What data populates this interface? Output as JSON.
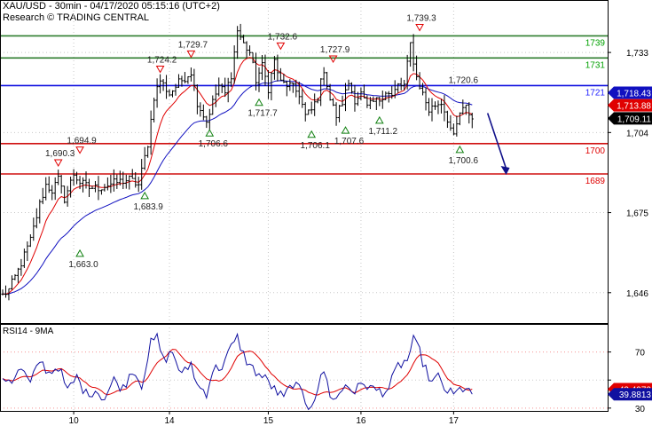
{
  "header": {
    "title": "XAU/USD - 30min - 04/17/2020 05:15:16 (UTC+2)",
    "credit": "Research © TRADING CENTRAL"
  },
  "chart_data": [
    {
      "type": "candlestick",
      "title": "XAU/USD - 30min - 04/17/2020 05:15:16 (UTC+2)",
      "ylim": [
        1635,
        1752
      ],
      "y_ticks": [
        1646,
        1675,
        1704,
        1733
      ],
      "y_tick_labels": [
        "1,646",
        "1,675",
        "1,704",
        "1,733"
      ],
      "x_ticks": [
        {
          "label": "10",
          "index": 23
        },
        {
          "label": "14",
          "index": 54
        },
        {
          "label": "15",
          "index": 86
        },
        {
          "label": "16",
          "index": 116
        },
        {
          "label": "17",
          "index": 146
        }
      ],
      "n_bars": 196,
      "last_bar_index": 152,
      "closes_waypoints": [
        [
          0,
          1645
        ],
        [
          2,
          1647
        ],
        [
          5,
          1654
        ],
        [
          9,
          1665
        ],
        [
          12,
          1678
        ],
        [
          14,
          1685
        ],
        [
          16,
          1683
        ],
        [
          18,
          1687
        ],
        [
          20,
          1680
        ],
        [
          23,
          1689
        ],
        [
          25,
          1686
        ],
        [
          28,
          1684
        ],
        [
          31,
          1684
        ],
        [
          34,
          1685
        ],
        [
          37,
          1686
        ],
        [
          41,
          1687
        ],
        [
          44,
          1685
        ],
        [
          47,
          1700
        ],
        [
          49,
          1717
        ],
        [
          51,
          1723
        ],
        [
          54,
          1718
        ],
        [
          57,
          1722
        ],
        [
          61,
          1726
        ],
        [
          63,
          1715
        ],
        [
          66,
          1708
        ],
        [
          68,
          1715
        ],
        [
          70,
          1721
        ],
        [
          72,
          1718
        ],
        [
          74,
          1725
        ],
        [
          76,
          1741
        ],
        [
          78,
          1736
        ],
        [
          80,
          1733
        ],
        [
          82,
          1723
        ],
        [
          84,
          1728
        ],
        [
          86,
          1720
        ],
        [
          88,
          1730
        ],
        [
          90,
          1722
        ],
        [
          93,
          1721
        ],
        [
          96,
          1718
        ],
        [
          98,
          1710
        ],
        [
          100,
          1712
        ],
        [
          102,
          1717
        ],
        [
          104,
          1727
        ],
        [
          106,
          1716
        ],
        [
          108,
          1710
        ],
        [
          110,
          1715
        ],
        [
          112,
          1722
        ],
        [
          114,
          1716
        ],
        [
          116,
          1718
        ],
        [
          118,
          1713
        ],
        [
          120,
          1715
        ],
        [
          122,
          1716
        ],
        [
          124,
          1719
        ],
        [
          126,
          1717
        ],
        [
          128,
          1721
        ],
        [
          130,
          1721
        ],
        [
          132,
          1736
        ],
        [
          134,
          1724
        ],
        [
          136,
          1718
        ],
        [
          138,
          1712
        ],
        [
          140,
          1714
        ],
        [
          142,
          1715
        ],
        [
          144,
          1709
        ],
        [
          146,
          1702
        ],
        [
          148,
          1711
        ],
        [
          150,
          1713
        ],
        [
          152,
          1709
        ]
      ],
      "series": [
        {
          "name": "price",
          "color": "#000000"
        },
        {
          "name": "ma_fast",
          "color": "#e00000"
        },
        {
          "name": "ma_slow",
          "color": "#1010c0"
        }
      ],
      "horizontal_levels": [
        {
          "value": 1739,
          "label": "1739",
          "color": "#00a000",
          "line_color": "#2e7d2e"
        },
        {
          "value": 1731,
          "label": "1731",
          "color": "#00a000",
          "line_color": "#2e7d2e"
        },
        {
          "value": 1721,
          "label": "1721",
          "color": "#1d1dff",
          "line_color": "#1010e0"
        },
        {
          "value": 1700,
          "label": "1700",
          "color": "#e00000",
          "line_color": "#d01010"
        },
        {
          "value": 1689,
          "label": "1689",
          "color": "#e00000",
          "line_color": "#d01010"
        }
      ],
      "price_tags": [
        {
          "value": 1718.43,
          "label": "1,718.43",
          "bg": "#1010c0",
          "fg": "#ffffff"
        },
        {
          "value": 1713.88,
          "label": "1,713.88",
          "bg": "#e00000",
          "fg": "#ffffff"
        },
        {
          "value": 1709.11,
          "label": "1,709.11",
          "bg": "#000000",
          "fg": "#ffffff"
        }
      ],
      "annotations": [
        {
          "text": "1,690.3",
          "index": 18,
          "value": 1690.3,
          "type": "high"
        },
        {
          "text": "1,694.9",
          "index": 25,
          "value": 1694.9,
          "type": "high"
        },
        {
          "text": "1,663.0",
          "index": 25,
          "value": 1663.0,
          "type": "low"
        },
        {
          "text": "1,683.9",
          "index": 46,
          "value": 1683.9,
          "type": "low"
        },
        {
          "text": "1,724.2",
          "index": 51,
          "value": 1724.2,
          "type": "high"
        },
        {
          "text": "1,729.7",
          "index": 61,
          "value": 1729.7,
          "type": "high"
        },
        {
          "text": "1,706.6",
          "index": 67,
          "value": 1706.6,
          "type": "low"
        },
        {
          "text": "1,717.7",
          "index": 83,
          "value": 1717.7,
          "type": "low"
        },
        {
          "text": "1,732.6",
          "index": 90,
          "value": 1732.6,
          "type": "high"
        },
        {
          "text": "1,706.1",
          "index": 100,
          "value": 1706.1,
          "type": "low"
        },
        {
          "text": "1,727.9",
          "index": 107,
          "value": 1727.9,
          "type": "high"
        },
        {
          "text": "1,707.6",
          "index": 111,
          "value": 1707.6,
          "type": "low"
        },
        {
          "text": "1,711.2",
          "index": 122,
          "value": 1711.2,
          "type": "low"
        },
        {
          "text": "1,739.3",
          "index": 135,
          "value": 1739.3,
          "type": "high"
        },
        {
          "text": "1,720.6",
          "index": 148,
          "value": 1720.6,
          "type": "none"
        },
        {
          "text": "1,700.6",
          "index": 148,
          "value": 1700.6,
          "type": "low"
        }
      ],
      "projection_arrow": {
        "from_index": 157,
        "from_value": 1711,
        "to_index": 163,
        "to_value": 1689,
        "color": "#10108a"
      },
      "grid": true
    },
    {
      "type": "line",
      "title": "RSI14 - 9MA",
      "ylim": [
        28,
        90
      ],
      "y_ticks": [
        30,
        50,
        70
      ],
      "y_tick_labels": [
        "30",
        "50",
        "70"
      ],
      "rsi_waypoints": [
        [
          0,
          52
        ],
        [
          3,
          50
        ],
        [
          6,
          58
        ],
        [
          9,
          47
        ],
        [
          12,
          64
        ],
        [
          15,
          55
        ],
        [
          18,
          60
        ],
        [
          21,
          42
        ],
        [
          24,
          52
        ],
        [
          27,
          40
        ],
        [
          30,
          43
        ],
        [
          33,
          37
        ],
        [
          36,
          50
        ],
        [
          39,
          44
        ],
        [
          42,
          58
        ],
        [
          45,
          47
        ],
        [
          48,
          76
        ],
        [
          50,
          80
        ],
        [
          52,
          64
        ],
        [
          55,
          70
        ],
        [
          58,
          53
        ],
        [
          61,
          62
        ],
        [
          63,
          46
        ],
        [
          66,
          41
        ],
        [
          68,
          57
        ],
        [
          71,
          60
        ],
        [
          74,
          73
        ],
        [
          76,
          80
        ],
        [
          78,
          68
        ],
        [
          80,
          60
        ],
        [
          83,
          54
        ],
        [
          86,
          49
        ],
        [
          88,
          43
        ],
        [
          91,
          37
        ],
        [
          94,
          48
        ],
        [
          97,
          40
        ],
        [
          99,
          30
        ],
        [
          101,
          38
        ],
        [
          104,
          57
        ],
        [
          106,
          40
        ],
        [
          108,
          36
        ],
        [
          111,
          47
        ],
        [
          114,
          42
        ],
        [
          117,
          48
        ],
        [
          120,
          43
        ],
        [
          123,
          42
        ],
        [
          125,
          44
        ],
        [
          128,
          60
        ],
        [
          131,
          64
        ],
        [
          133,
          78
        ],
        [
          135,
          70
        ],
        [
          137,
          57
        ],
        [
          139,
          48
        ],
        [
          141,
          52
        ],
        [
          143,
          44
        ],
        [
          146,
          39
        ],
        [
          148,
          43
        ],
        [
          150,
          45
        ],
        [
          152,
          39.88
        ]
      ],
      "series": [
        {
          "name": "RSI14",
          "color": "#1010a0",
          "last": 39.8813,
          "last_label": "39.8813"
        },
        {
          "name": "9MA",
          "color": "#e00000",
          "last": 43.4972,
          "last_label": "43.4972"
        }
      ],
      "grid": true
    }
  ]
}
